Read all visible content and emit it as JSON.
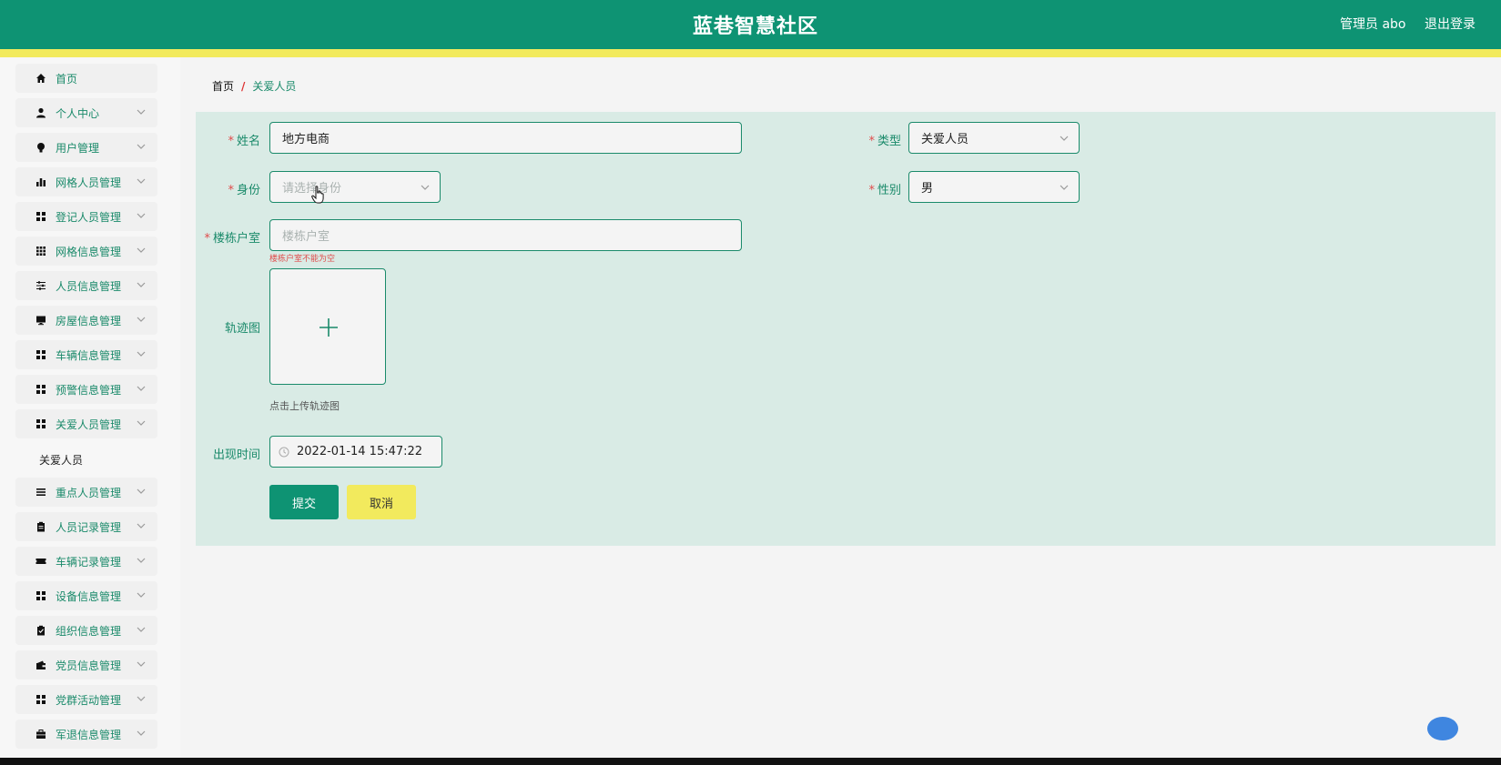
{
  "header": {
    "title": "蓝巷智慧社区",
    "admin": "管理员 abo",
    "logout": "退出登录"
  },
  "sidebar": {
    "items": [
      {
        "label": "首页",
        "icon": "home-icon",
        "expandable": false
      },
      {
        "label": "个人中心",
        "icon": "user-icon",
        "expandable": true
      },
      {
        "label": "用户管理",
        "icon": "bulb-icon",
        "expandable": true
      },
      {
        "label": "网格人员管理",
        "icon": "bar-chart-icon",
        "expandable": true
      },
      {
        "label": "登记人员管理",
        "icon": "grid-icon",
        "expandable": true
      },
      {
        "label": "网格信息管理",
        "icon": "grid9-icon",
        "expandable": true
      },
      {
        "label": "人员信息管理",
        "icon": "sliders-icon",
        "expandable": true
      },
      {
        "label": "房屋信息管理",
        "icon": "monitor-icon",
        "expandable": true
      },
      {
        "label": "车辆信息管理",
        "icon": "grid-icon",
        "expandable": true
      },
      {
        "label": "预警信息管理",
        "icon": "grid-icon",
        "expandable": true
      },
      {
        "label": "关爱人员管理",
        "icon": "grid-icon",
        "expandable": true
      }
    ],
    "sub_item": "关爱人员",
    "items_after": [
      {
        "label": "重点人员管理",
        "icon": "list-icon",
        "expandable": true
      },
      {
        "label": "人员记录管理",
        "icon": "clipboard-icon",
        "expandable": true
      },
      {
        "label": "车辆记录管理",
        "icon": "ticket-icon",
        "expandable": true
      },
      {
        "label": "设备信息管理",
        "icon": "grid-icon",
        "expandable": true
      },
      {
        "label": "组织信息管理",
        "icon": "clipboard-check-icon",
        "expandable": true
      },
      {
        "label": "党员信息管理",
        "icon": "wallet-icon",
        "expandable": true
      },
      {
        "label": "党群活动管理",
        "icon": "grid-icon",
        "expandable": true
      },
      {
        "label": "军退信息管理",
        "icon": "briefcase-icon",
        "expandable": true
      }
    ]
  },
  "breadcrumb": {
    "home": "首页",
    "separator": "/",
    "current": "关爱人员"
  },
  "form": {
    "name": {
      "label": "姓名",
      "value": "地方电商",
      "required": true
    },
    "type": {
      "label": "类型",
      "value": "关爱人员",
      "required": true
    },
    "identity": {
      "label": "身份",
      "placeholder": "请选择身份",
      "required": true
    },
    "gender": {
      "label": "性别",
      "value": "男",
      "required": true
    },
    "room": {
      "label": "楼栋户室",
      "placeholder": "楼栋户室",
      "required": true,
      "error": "楼栋户室不能为空"
    },
    "track": {
      "label": "轨迹图",
      "hint": "点击上传轨迹图"
    },
    "time": {
      "label": "出现时间",
      "value": "2022-01-14 15:47:22"
    },
    "submit": "提交",
    "cancel": "取消"
  },
  "colors": {
    "primary": "#0e9373",
    "accent_yellow": "#f2ea5d",
    "error": "#e04b4b",
    "panel": "#d9ebe5"
  }
}
